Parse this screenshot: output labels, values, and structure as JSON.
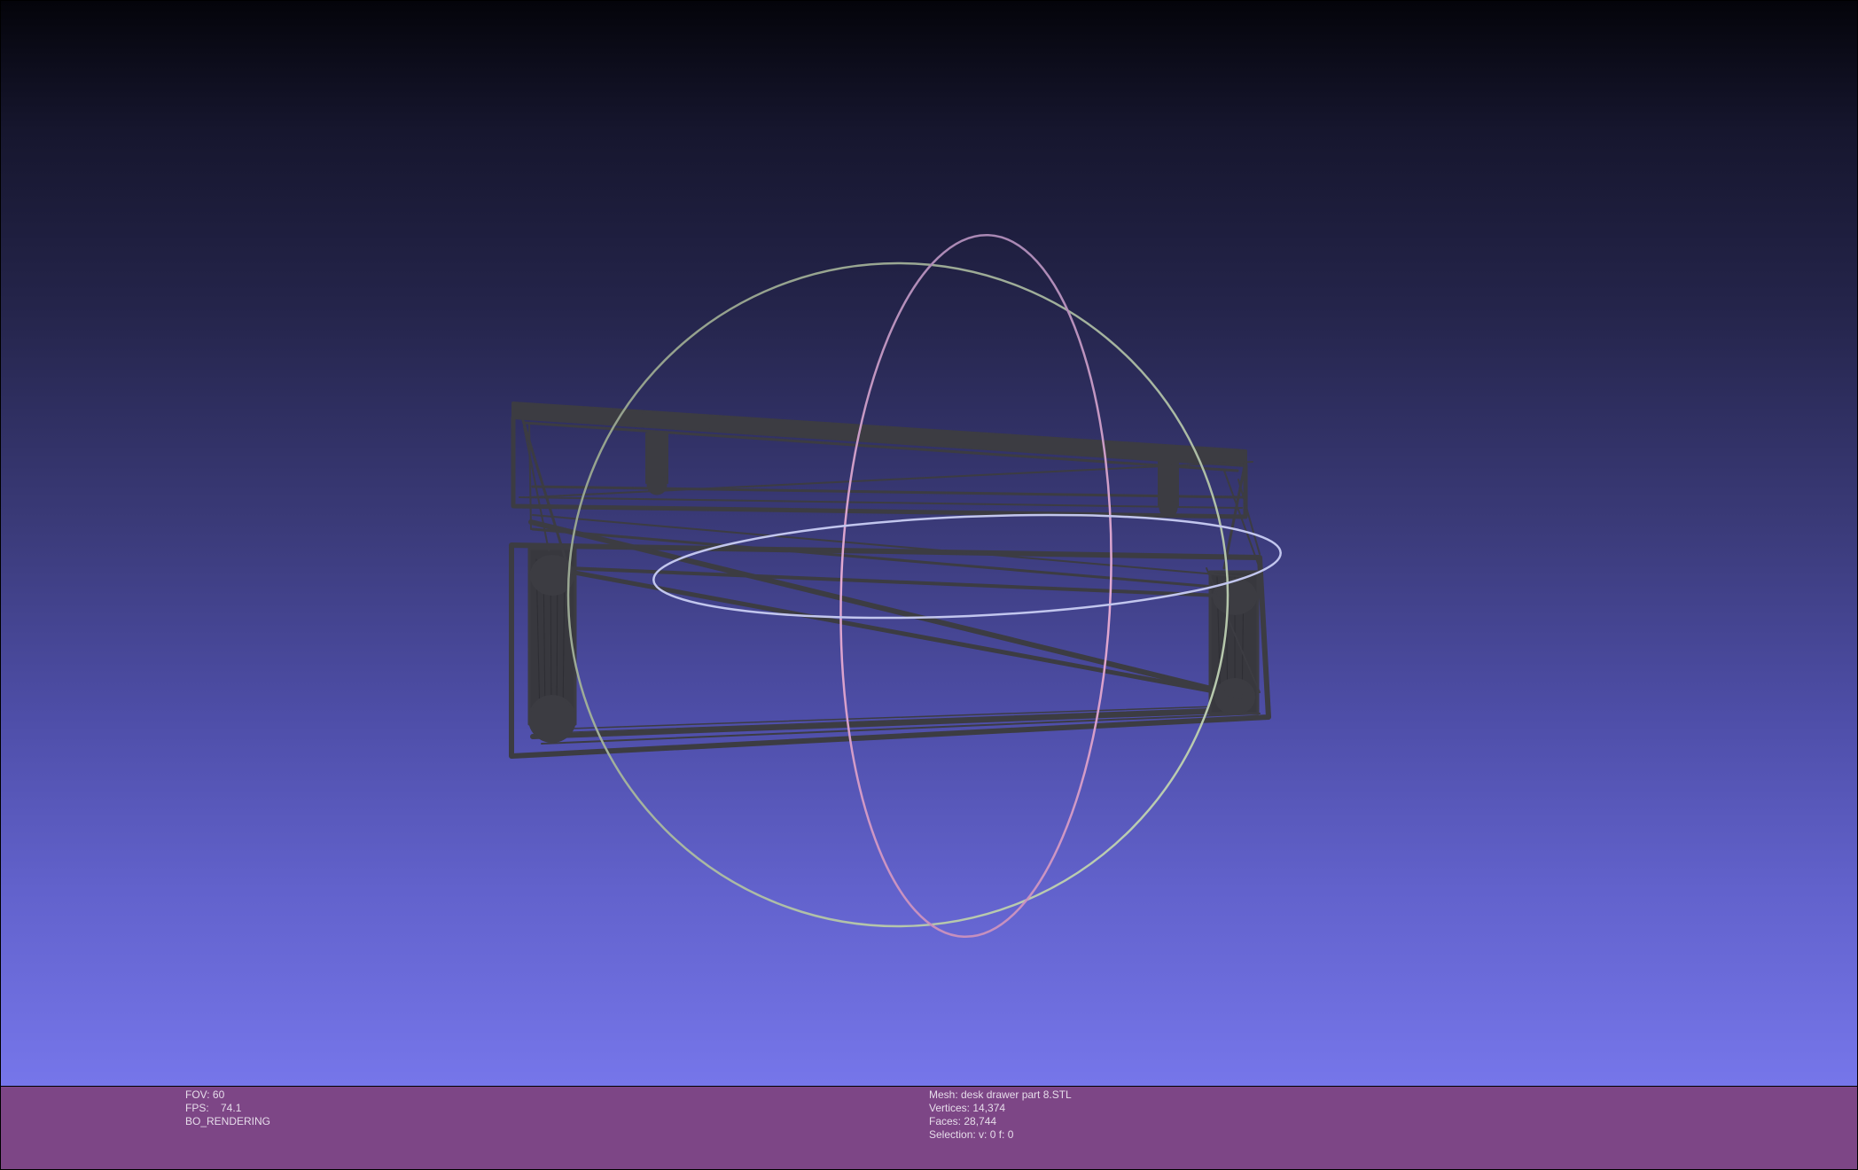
{
  "viewer": {
    "mesh_color": "#3c3c42",
    "trackball_colors": {
      "xz_ring": "#9fa6d8",
      "yz_ring": "#b38fb8",
      "xy_ring": "#b3c8a8"
    }
  },
  "info_bar": {
    "background": "#7d4686",
    "left": {
      "fov": "FOV: 60",
      "fps": "FPS:    74.1",
      "mode": "BO_RENDERING"
    },
    "right": {
      "mesh": "Mesh: desk drawer part 8.STL",
      "vertices": "Vertices: 14,374",
      "faces": "Faces: 28,744",
      "selection": "Selection: v: 0 f: 0"
    }
  }
}
